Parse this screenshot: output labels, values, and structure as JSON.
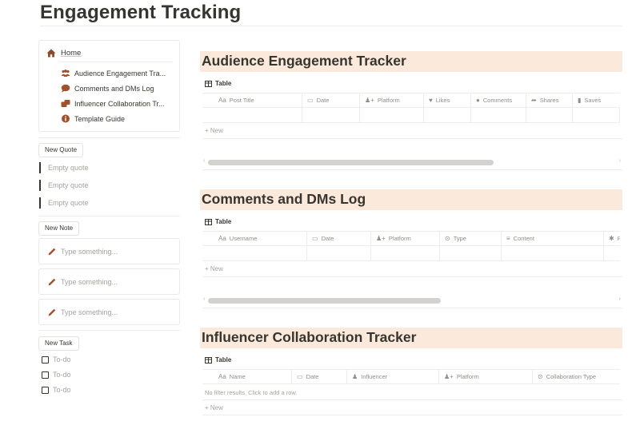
{
  "page": {
    "title": "Engagement Tracking"
  },
  "nav": {
    "home": "Home",
    "items": [
      {
        "label": "Audience Engagement Tra...",
        "icon": "people-icon"
      },
      {
        "label": "Comments and DMs Log",
        "icon": "speech-bubble-icon"
      },
      {
        "label": "Influencer Collaboration Tr...",
        "icon": "handshake-icon"
      },
      {
        "label": "Template Guide",
        "icon": "info-icon"
      }
    ]
  },
  "quotes": {
    "button": "New Quote",
    "items": [
      "Empty quote",
      "Empty quote",
      "Empty quote"
    ]
  },
  "notes": {
    "button": "New Note",
    "items": [
      "Type something...",
      "Type something...",
      "Type something..."
    ]
  },
  "tasks": {
    "button": "New Task",
    "items": [
      "To-do",
      "To-do",
      "To-do"
    ]
  },
  "sections": [
    {
      "title": "Audience Engagement Tracker",
      "view": "Table",
      "columns": [
        {
          "label": "Post Title",
          "prefix": "Aa"
        },
        {
          "label": "Date",
          "icon": "calendar-icon"
        },
        {
          "label": "Platform",
          "icon": "people-plus-icon"
        },
        {
          "label": "Likes",
          "icon": "heart-icon"
        },
        {
          "label": "Comments",
          "icon": "comment-icon"
        },
        {
          "label": "Shares",
          "icon": "share-arrow-icon"
        },
        {
          "label": "Saves",
          "icon": "bookmark-icon"
        }
      ],
      "new_label": "+ New",
      "scroll_fraction": 0.7
    },
    {
      "title": "Comments and DMs Log",
      "view": "Table",
      "columns": [
        {
          "label": "Username",
          "prefix": "Aa"
        },
        {
          "label": "Date",
          "icon": "calendar-icon"
        },
        {
          "label": "Platform",
          "icon": "people-plus-icon"
        },
        {
          "label": "Type",
          "icon": "status-icon"
        },
        {
          "label": "Content",
          "icon": "text-lines-icon"
        },
        {
          "label": "R",
          "icon": "asterisk-icon"
        }
      ],
      "new_label": "+ New",
      "scroll_fraction": 0.57
    },
    {
      "title": "Influencer Collaboration Tracker",
      "view": "Table",
      "columns": [
        {
          "label": "Name",
          "prefix": "Aa"
        },
        {
          "label": "Date",
          "icon": "calendar-icon"
        },
        {
          "label": "Influencer",
          "icon": "person-icon"
        },
        {
          "label": "Platform",
          "icon": "people-plus-icon"
        },
        {
          "label": "Collaboration Type",
          "icon": "status-icon"
        }
      ],
      "empty_text": "No filter results. Click to add a row.",
      "new_label": "+ New"
    }
  ],
  "colors": {
    "section_header_bg": "#fbeadb",
    "nav_icon": "#a0522d",
    "text": "#37352f",
    "muted": "#a5a39f"
  }
}
